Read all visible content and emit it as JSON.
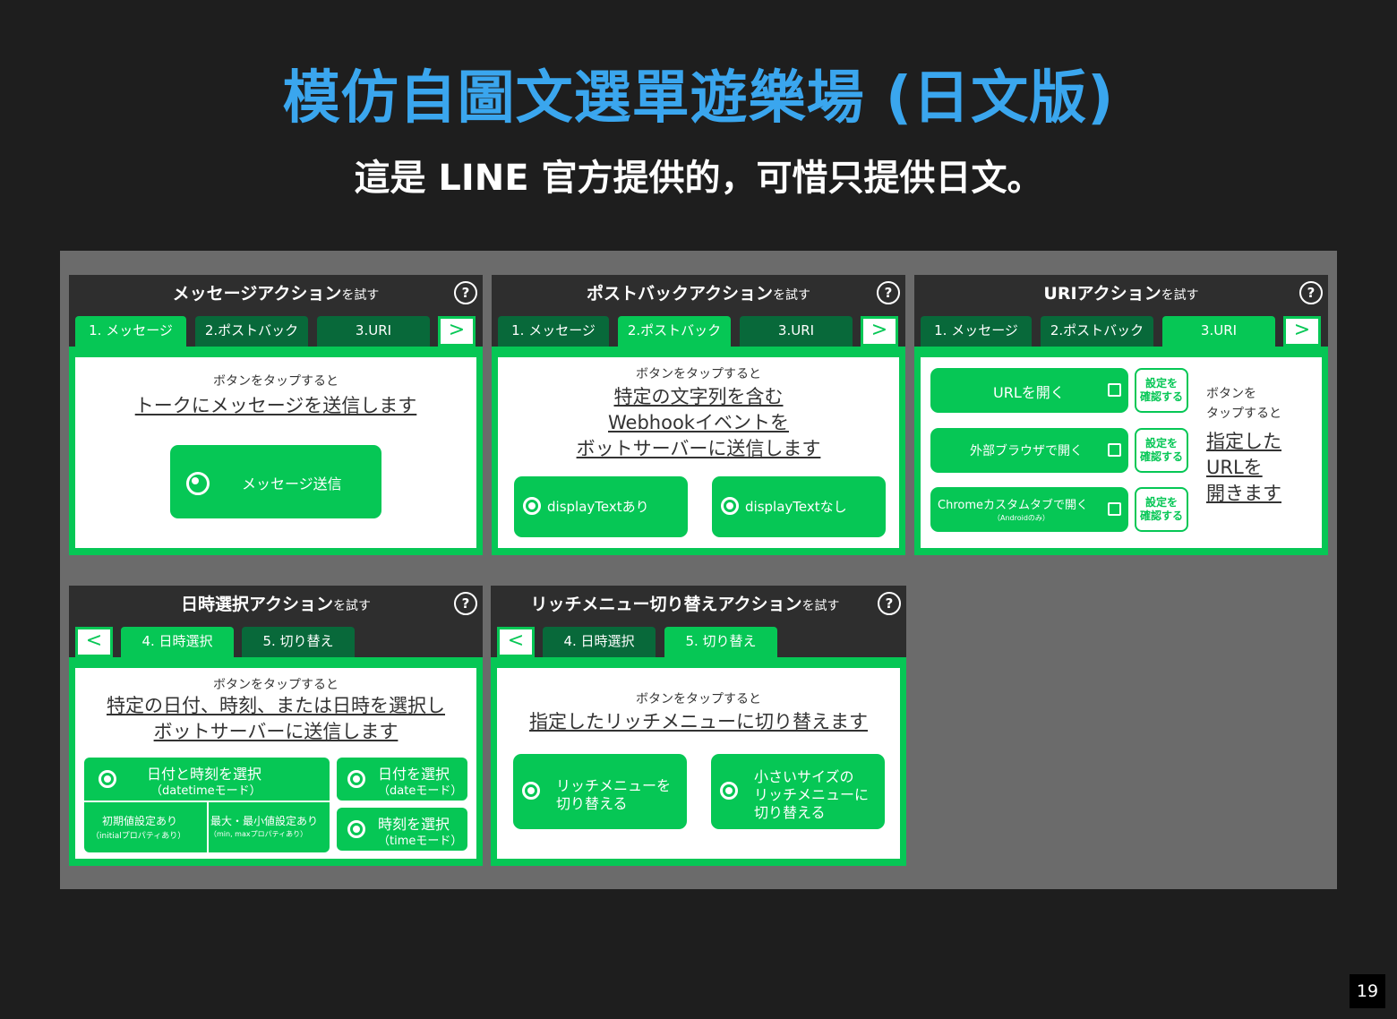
{
  "slide": {
    "title": "模仿自圖文選單遊樂場 (日文版)",
    "subtitle": "這是 LINE 官方提供的，可惜只提供日文。",
    "page_number": "19"
  },
  "common": {
    "title_suffix": "を試す",
    "help_icon": "?",
    "tap_prompt": "ボタンをタップすると",
    "tabs": [
      "1. メッセージ",
      "2.ポストバック",
      "3.URI",
      "4. 日時選択",
      "5. 切り替え"
    ],
    "next_arrow": ">",
    "prev_arrow": "<"
  },
  "panel_message": {
    "title": "メッセージアクション",
    "description": "トークにメッセージを送信します",
    "button": "メッセージ送信"
  },
  "panel_postback": {
    "title": "ポストバックアクション",
    "description_lines": [
      "特定の文字列を含む",
      "Webhookイベントを",
      "ボットサーバーに送信します"
    ],
    "button_with": "displayTextあり",
    "button_without": "displayTextなし"
  },
  "panel_uri": {
    "title": "URIアクション",
    "buttons": [
      "URLを開く",
      "外部ブラウザで開く",
      "Chromeカスタムタブで開く"
    ],
    "chrome_note": "（Androidのみ）",
    "confirm_line1": "設定を",
    "confirm_line2": "確認する",
    "side_lines": [
      "ボタンを",
      "タップすると",
      "指定した",
      "URLを",
      "開きます"
    ]
  },
  "panel_datetime": {
    "title": "日時選択アクション",
    "description_lines": [
      "特定の日付、時刻、または日時を選択し",
      "ボットサーバーに送信します"
    ],
    "datetime_button": "日付と時刻を選択",
    "datetime_mode": "（datetimeモード）",
    "initial_option": "初期値設定あり",
    "initial_note": "（initialプロパティあり）",
    "minmax_option": "最大・最小値設定あり",
    "minmax_note": "（min, maxプロパティあり）",
    "date_button": "日付を選択",
    "date_mode": "（dateモード）",
    "time_button": "時刻を選択",
    "time_mode": "（timeモード）"
  },
  "panel_switch": {
    "title": "リッチメニュー切り替えアクション",
    "description": "指定したリッチメニューに切り替えます",
    "button1_lines": [
      "リッチメニューを",
      "切り替える"
    ],
    "button2_lines": [
      "小さいサイズの",
      "リッチメニューに",
      "切り替える"
    ]
  },
  "colors": {
    "title_blue": "#3aa6ee",
    "line_green": "#06c755",
    "tab_dark_green": "#08693a",
    "header_dark": "#2e2e2e",
    "slide_bg": "#1e1e1e",
    "canvas_gray": "#6b6b6b"
  }
}
